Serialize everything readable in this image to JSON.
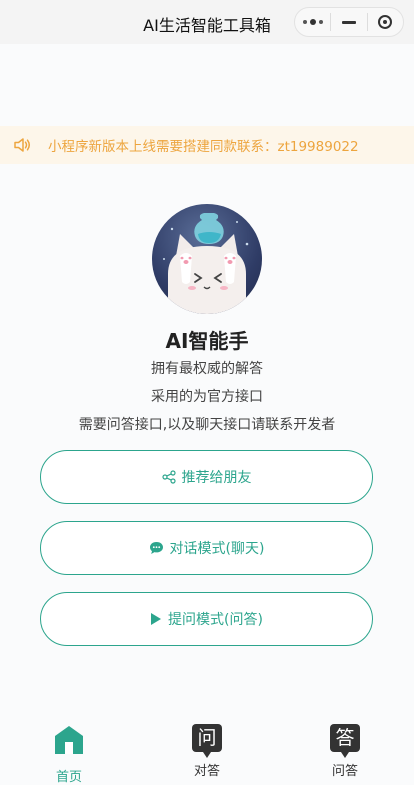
{
  "navbar": {
    "title": "AI生活智能工具箱"
  },
  "notice": {
    "text": "小程序新版本上线需要搭建同款联系：zt19989022"
  },
  "profile": {
    "name": "AI智能手",
    "lines": [
      "拥有最权威的解答",
      "采用的为官方接口",
      "需要问答接口,以及聊天接口请联系开发者"
    ]
  },
  "buttons": {
    "share": "推荐给朋友",
    "chat": "对话模式(聊天)",
    "qa": "提问模式(问答)"
  },
  "tabbar": {
    "home": "首页",
    "chat": "对答",
    "chat_icon_char": "问",
    "qa": "问答",
    "qa_icon_char": "答"
  },
  "colors": {
    "accent": "#2ca58d",
    "notice_text": "#eda53f",
    "notice_bg": "#fdf6ea"
  },
  "icons": {
    "notice": "speaker-icon",
    "share": "share-icon",
    "chat": "chat-bubble-icon",
    "qa": "play-icon",
    "home": "home-icon"
  }
}
